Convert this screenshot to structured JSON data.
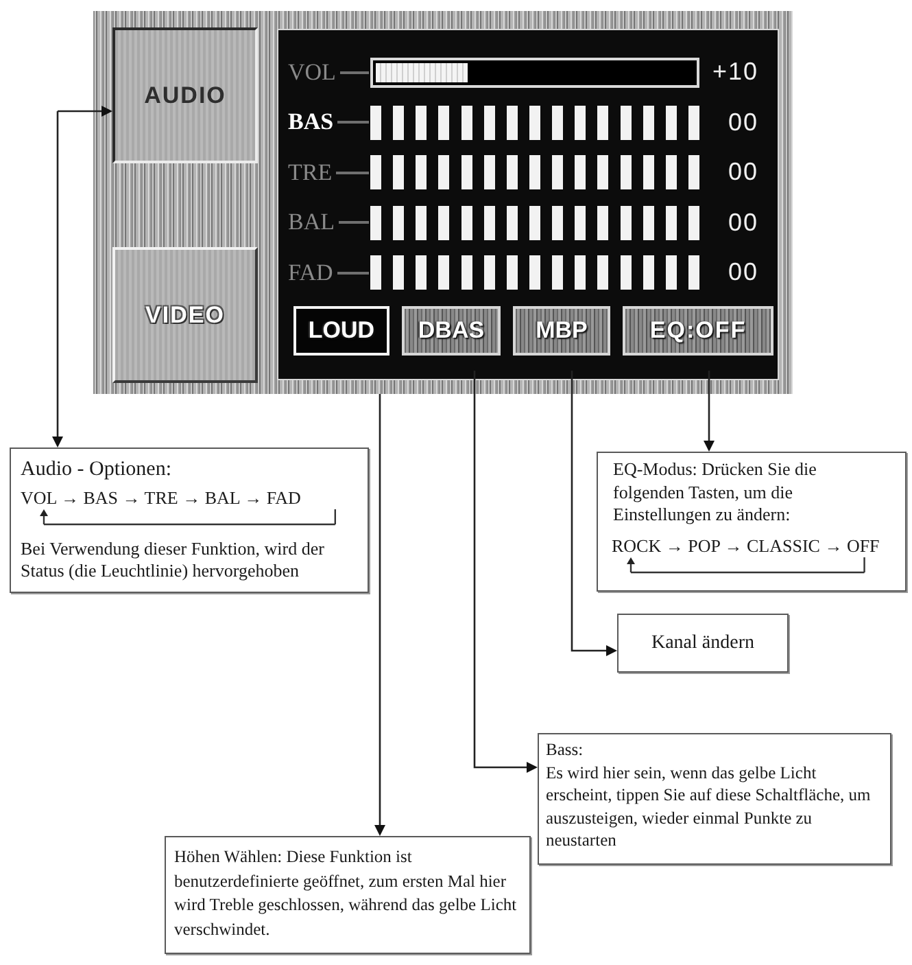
{
  "screen": {
    "sources": [
      {
        "label": "AUDIO",
        "selected": true
      },
      {
        "label": "VIDEO",
        "selected": false
      }
    ],
    "rows": [
      {
        "label": "VOL",
        "kind": "bar",
        "level": 0.29,
        "value": "+10",
        "selected": false
      },
      {
        "label": "BAS",
        "kind": "segments",
        "level": 1,
        "value": "00",
        "selected": true
      },
      {
        "label": "TRE",
        "kind": "segments",
        "level": 1,
        "value": "00",
        "selected": false
      },
      {
        "label": "BAL",
        "kind": "segments",
        "level": 1,
        "value": "00",
        "selected": false
      },
      {
        "label": "FAD",
        "kind": "segments",
        "level": 1,
        "value": "00",
        "selected": false
      }
    ],
    "buttons": [
      {
        "label": "LOUD",
        "selected": true
      },
      {
        "label": "DBAS",
        "selected": false
      },
      {
        "label": "MBP",
        "selected": false
      },
      {
        "label": "EQ:OFF",
        "selected": false
      }
    ]
  },
  "callouts": [
    {
      "parts": [
        {
          "kind": "heading",
          "text": "Audio - Optionen:"
        },
        {
          "kind": "flow",
          "text": "VOL → BAS → TRE → BAL → FAD"
        },
        {
          "kind": "text",
          "text": "Bei Verwendung dieser Funktion, wird der Status (die Leuchtlinie) hervorgehoben"
        }
      ]
    },
    {
      "parts": [
        {
          "kind": "text",
          "text": "EQ-Modus: Drücken Sie die folgenden Tasten, um die Einstellungen zu ändern:"
        },
        {
          "kind": "flow",
          "text": "ROCK → POP → CLASSIC → OFF"
        }
      ]
    },
    {
      "parts": [
        {
          "kind": "text",
          "text": "Kanal ändern"
        }
      ]
    },
    {
      "parts": [
        {
          "kind": "heading",
          "text": "Bass:"
        },
        {
          "kind": "text",
          "text": "Es wird hier sein, wenn das gelbe Licht erscheint, tippen Sie auf diese Schaltfläche, um auszusteigen, wieder einmal Punkte zu neustarten"
        }
      ]
    },
    {
      "parts": [
        {
          "kind": "text",
          "text": "Höhen Wählen: Diese Funktion ist benutzerdefinierte geöffnet, zum ersten Mal hier wird Treble geschlossen, während das gelbe Licht verschwindet."
        }
      ]
    }
  ]
}
